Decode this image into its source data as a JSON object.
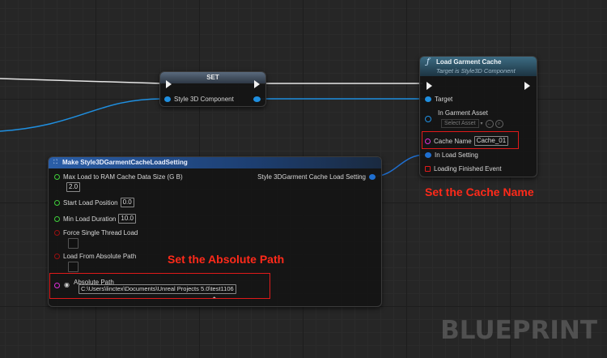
{
  "set_node": {
    "title": "SET",
    "pin_label": "Style 3D Component"
  },
  "load_node": {
    "title": "Load Garment Cache",
    "subtitle": "Target is Style3D Component",
    "target_label": "Target",
    "asset_label": "In Garment Asset",
    "asset_placeholder": "Select Asset",
    "cache_name_label": "Cache Name",
    "cache_name_value": "Cache_01",
    "load_setting_label": "In Load Setting",
    "event_label": "Loading Finished Event"
  },
  "make_node": {
    "title": "Make Style3DGarmentCacheLoadSetting",
    "output_label": "Style 3DGarment Cache Load Setting",
    "max_load_label": "Max Load to RAM Cache Data Size (G B)",
    "max_load_value": "2.0",
    "start_pos_label": "Start Load Position",
    "start_pos_value": "0.0",
    "min_duration_label": "Min Load Duration",
    "min_duration_value": "10.0",
    "force_single_label": "Force Single Thread Load",
    "absolute_toggle_label": "Load From Absolute Path",
    "abs_path_label": "Absolute Path",
    "abs_path_value": "C:\\Users\\linctex\\Documents\\Unreal Projects 5.0\\test1106"
  },
  "annotations": {
    "cache_name": "Set the Cache Name",
    "absolute_path": "Set the Absolute Path"
  },
  "watermark": "BLUEPRINT",
  "colors": {
    "object_pin": "#1f8fe0",
    "float_pin": "#3fcf3a",
    "bool_pin": "#9a1010",
    "string_pin": "#e12fd8",
    "struct_pin": "#1f6fd0",
    "annotation": "#ff2a1a"
  }
}
